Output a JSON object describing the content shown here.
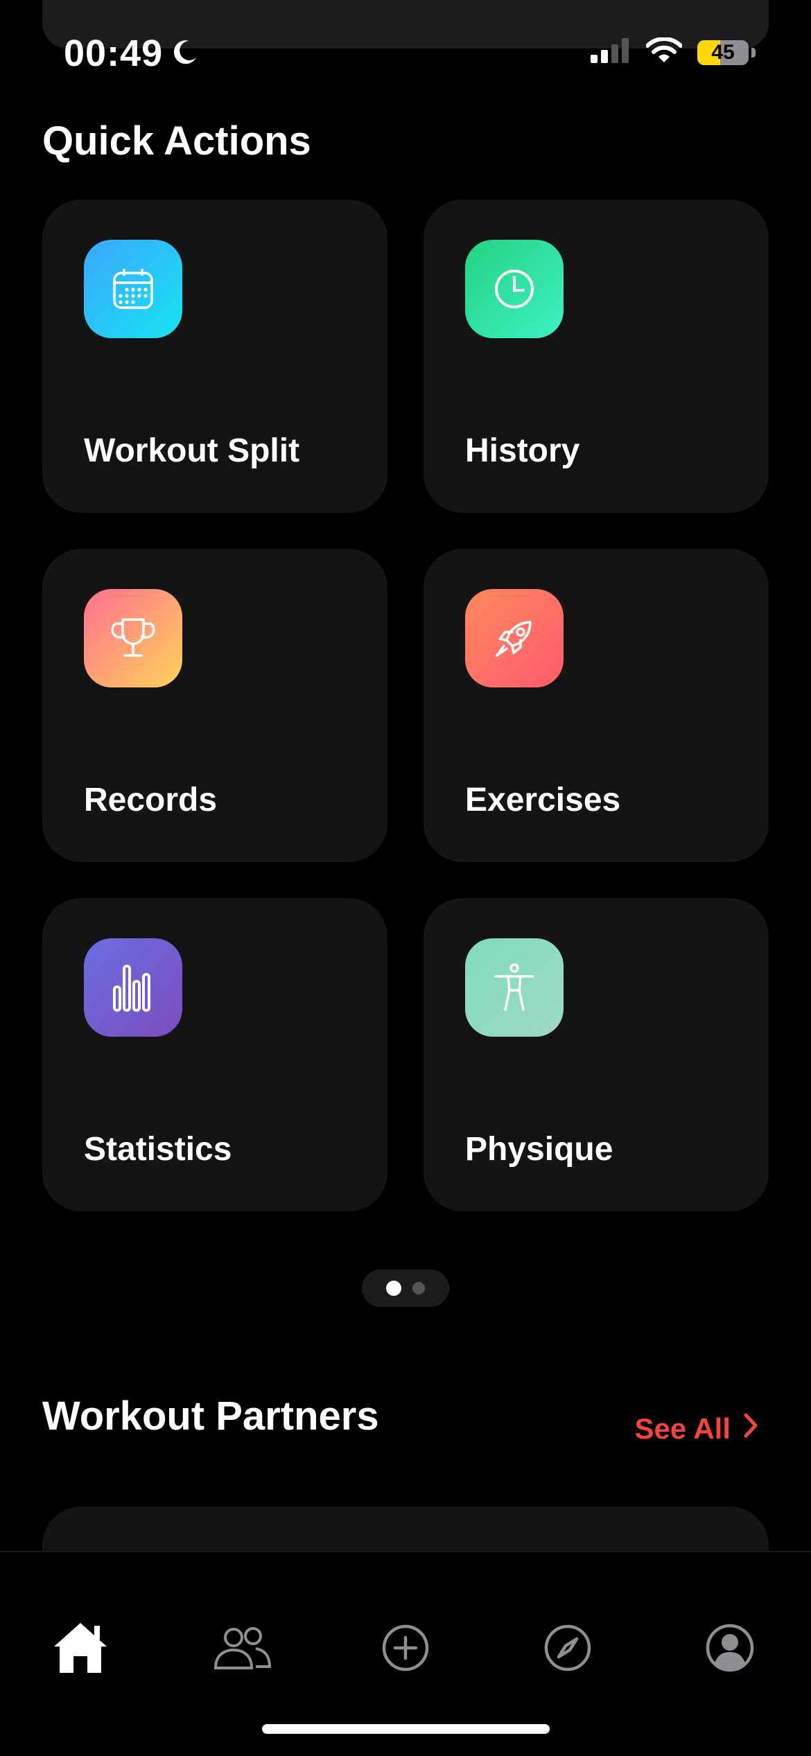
{
  "status_bar": {
    "time": "00:49",
    "battery": "45",
    "battery_level": 0.45
  },
  "quick_actions": {
    "title": "Quick Actions",
    "tiles": [
      {
        "label": "Workout Split",
        "icon": "calendar-icon",
        "gradient": [
          "#3aa8ff",
          "#17e3f0"
        ]
      },
      {
        "label": "History",
        "icon": "clock-icon",
        "gradient": [
          "#22d47e",
          "#3ff0c6"
        ]
      },
      {
        "label": "Records",
        "icon": "trophy-icon",
        "gradient": [
          "#ff6f91",
          "#ffd35a"
        ]
      },
      {
        "label": "Exercises",
        "icon": "rocket-icon",
        "gradient": [
          "#ff8a5c",
          "#ff5a6e"
        ]
      },
      {
        "label": "Statistics",
        "icon": "bar-chart-icon",
        "gradient": [
          "#6a6ee0",
          "#7c4dbf"
        ]
      },
      {
        "label": "Physique",
        "icon": "figure-icon",
        "gradient": [
          "#7fdcbf",
          "#9fd8c6"
        ]
      }
    ],
    "pager": {
      "pages": 2,
      "current": 1
    }
  },
  "workout_partners": {
    "title": "Workout Partners",
    "see_all": "See All"
  },
  "tab_bar": {
    "items": [
      {
        "icon": "home-icon",
        "active": true
      },
      {
        "icon": "people-icon",
        "active": false
      },
      {
        "icon": "plus-circle-icon",
        "active": false
      },
      {
        "icon": "compass-icon",
        "active": false
      },
      {
        "icon": "profile-icon",
        "active": false
      }
    ]
  },
  "colors": {
    "accent": "#f2453d",
    "background": "#000000",
    "card": "#141414"
  }
}
